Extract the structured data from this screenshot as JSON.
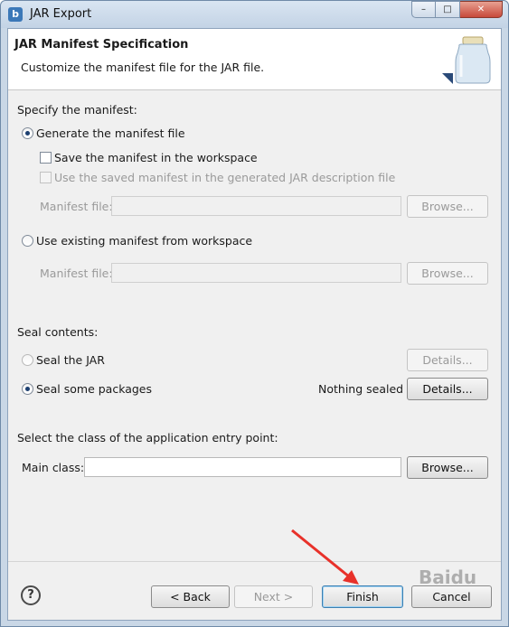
{
  "window": {
    "title": "JAR Export",
    "app_icon_letter": "b",
    "minimize": "–",
    "maximize": "□",
    "close": "✕"
  },
  "header": {
    "title": "JAR Manifest Specification",
    "description": "Customize the manifest file for the JAR file."
  },
  "manifest": {
    "section_label": "Specify the manifest:",
    "generate_option": "Generate the manifest file",
    "save_in_workspace": "Save the manifest in the workspace",
    "use_saved_manifest": "Use the saved manifest in the generated JAR description file",
    "manifest_file_label_1": "Manifest file:",
    "manifest_file_value_1": "",
    "browse_1": "Browse...",
    "use_existing_option": "Use existing manifest from workspace",
    "manifest_file_label_2": "Manifest file:",
    "manifest_file_value_2": "",
    "browse_2": "Browse..."
  },
  "seal": {
    "section_label": "Seal contents:",
    "seal_jar_option": "Seal the JAR",
    "details_1": "Details...",
    "seal_packages_option": "Seal some packages",
    "status": "Nothing sealed",
    "details_2": "Details..."
  },
  "entry_point": {
    "section_label": "Select the class of the application entry point:",
    "main_class_label": "Main class:",
    "main_class_value": "",
    "browse": "Browse..."
  },
  "footer": {
    "help": "?",
    "back": "< Back",
    "next": "Next >",
    "finish": "Finish",
    "cancel": "Cancel"
  },
  "watermark": "Baidu"
}
